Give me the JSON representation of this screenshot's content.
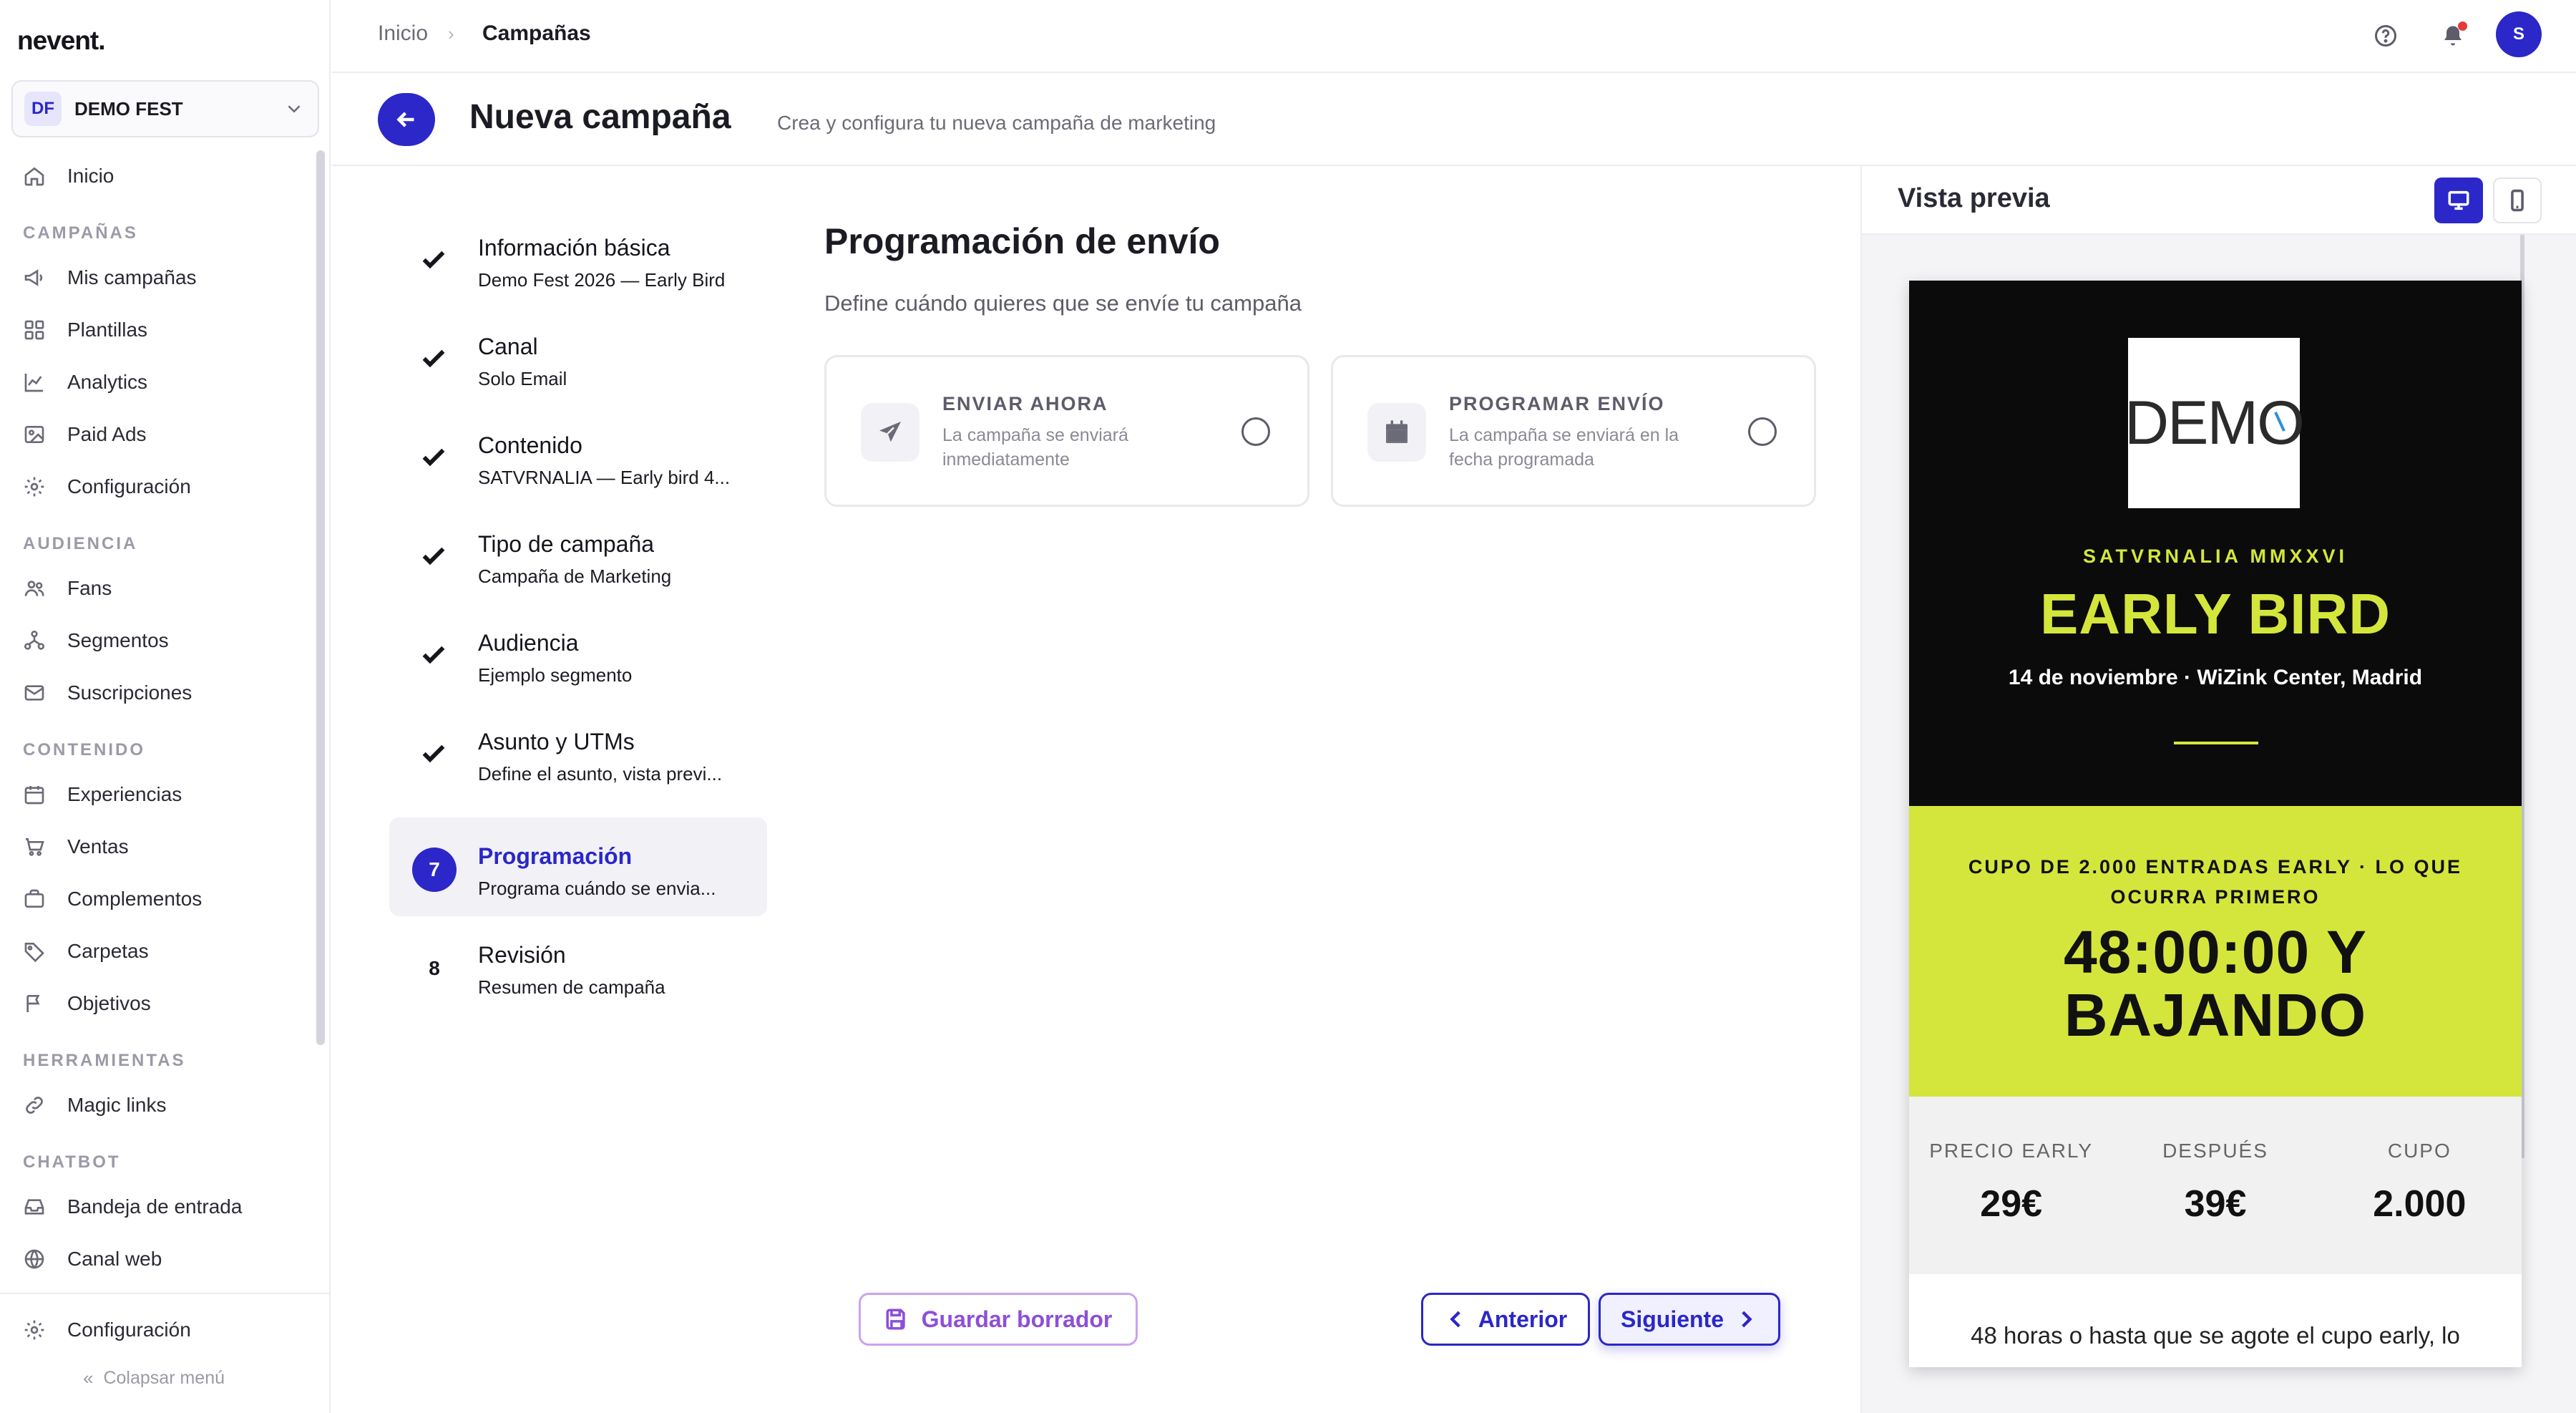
{
  "app": {
    "logo": "nevent."
  },
  "org": {
    "initials": "DF",
    "name": "DEMO FEST"
  },
  "sidebar": {
    "home": "Inicio",
    "sections": {
      "campaigns": "CAMPAÑAS",
      "audience": "AUDIENCIA",
      "content": "CONTENIDO",
      "tools": "HERRAMIENTAS",
      "chatbot": "CHATBOT"
    },
    "items": {
      "my_campaigns": "Mis campañas",
      "templates": "Plantillas",
      "analytics": "Analytics",
      "paid_ads": "Paid Ads",
      "config_campaigns": "Configuración",
      "fans": "Fans",
      "segments": "Segmentos",
      "subscriptions": "Suscripciones",
      "experiences": "Experiencias",
      "sales": "Ventas",
      "addons": "Complementos",
      "folders": "Carpetas",
      "goals": "Objetivos",
      "magic_links": "Magic links",
      "inbox": "Bandeja de entrada",
      "web_channel": "Canal web"
    },
    "settings": "Configuración",
    "collapse": "Colapsar menú"
  },
  "breadcrumb": {
    "home": "Inicio",
    "current": "Campañas"
  },
  "user": {
    "initial": "S"
  },
  "header": {
    "title": "Nueva campaña",
    "subtitle": "Crea y configura tu nueva campaña de marketing"
  },
  "steps": [
    {
      "title": "Información básica",
      "subtitle": "Demo Fest 2026 — Early Bird",
      "status": "done"
    },
    {
      "title": "Canal",
      "subtitle": "Solo Email",
      "status": "done"
    },
    {
      "title": "Contenido",
      "subtitle": "SATVRNALIA — Early bird 4...",
      "status": "done"
    },
    {
      "title": "Tipo de campaña",
      "subtitle": "Campaña de Marketing",
      "status": "done"
    },
    {
      "title": "Audiencia",
      "subtitle": "Ejemplo segmento",
      "status": "done"
    },
    {
      "title": "Asunto y UTMs",
      "subtitle": "Define el asunto, vista previ...",
      "status": "done"
    },
    {
      "number": "7",
      "title": "Programación",
      "subtitle": "Programa cuándo se envia...",
      "status": "active"
    },
    {
      "number": "8",
      "title": "Revisión",
      "subtitle": "Resumen de campaña",
      "status": "pending"
    }
  ],
  "schedule": {
    "title": "Programación de envío",
    "subtitle": "Define cuándo quieres que se envíe tu campaña",
    "options": [
      {
        "title": "ENVIAR AHORA",
        "description": "La campaña se enviará inmediatamente",
        "icon": "send-icon"
      },
      {
        "title": "PROGRAMAR ENVÍO",
        "description": "La campaña se enviará en la fecha programada",
        "icon": "calendar-icon"
      }
    ]
  },
  "actions": {
    "save_draft": "Guardar borrador",
    "previous": "Anterior",
    "next": "Siguiente"
  },
  "preview": {
    "title": "Vista previa",
    "email": {
      "logo_text": "DEM",
      "logo_last": "O",
      "eyebrow": "SATVRNALIA MMXXVI",
      "headline": "EARLY BIRD",
      "date_line": "14 de noviembre · WiZink Center, Madrid",
      "band_note": "CUPO DE 2.000 ENTRADAS EARLY · LO QUE OCURRA PRIMERO",
      "band_big": "48:00:00 Y BAJANDO",
      "stats": [
        {
          "label": "PRECIO EARLY",
          "value": "29€"
        },
        {
          "label": "DESPUÉS",
          "value": "39€"
        },
        {
          "label": "CUPO",
          "value": "2.000"
        }
      ],
      "body": "48 horas o hasta que se agote el cupo early, lo"
    }
  },
  "colors": {
    "brand": "#2b27c9",
    "accent": "#d4e63c",
    "draft": "#8d4fd8"
  }
}
